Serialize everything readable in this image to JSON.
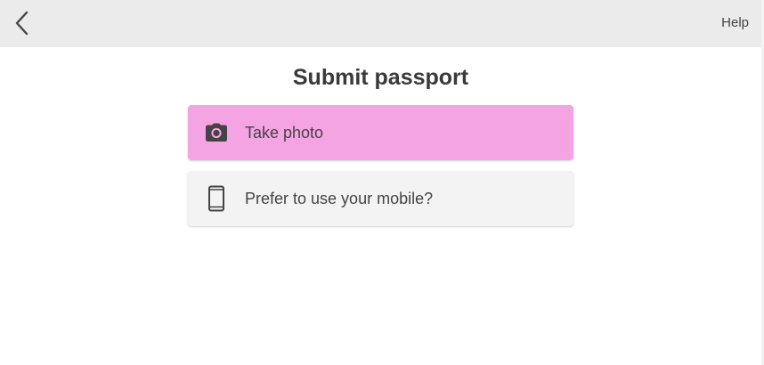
{
  "header": {
    "back_icon": "chevron-left-icon",
    "help_label": "Help"
  },
  "main": {
    "title": "Submit passport",
    "options": [
      {
        "label": "Take photo",
        "icon": "camera-icon",
        "color": "#f5a4e3"
      },
      {
        "label": "Prefer to use your mobile?",
        "icon": "mobile-phone-icon",
        "color": "#f3f3f3"
      }
    ]
  }
}
